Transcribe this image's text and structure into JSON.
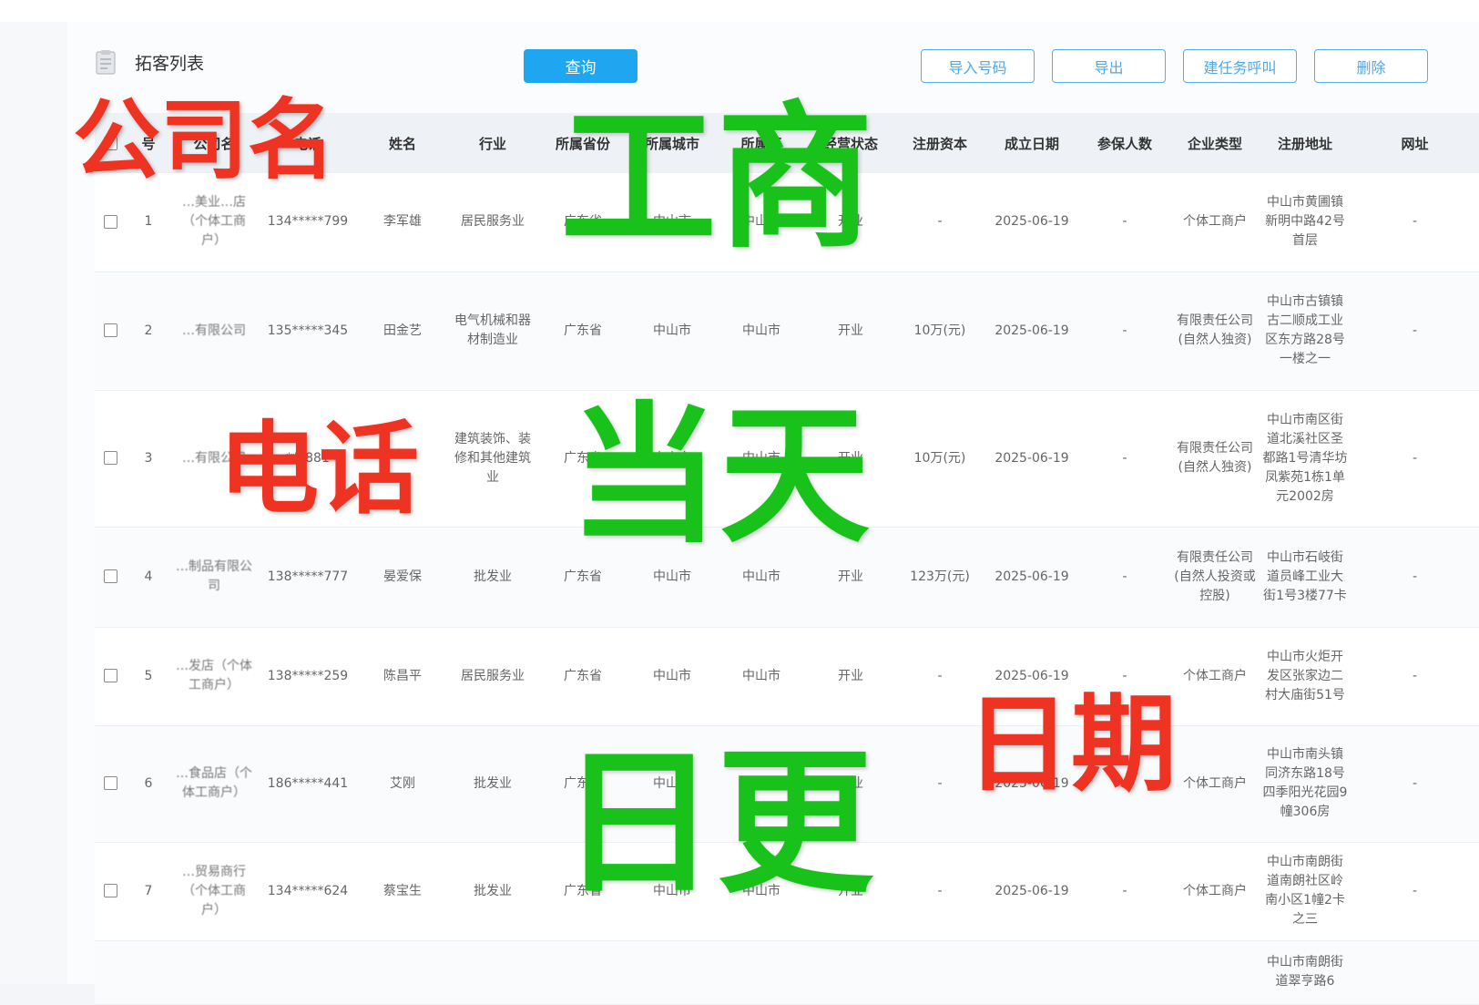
{
  "page": {
    "title": "拓客列表"
  },
  "toolbar": {
    "query": "查询",
    "import": "导入号码",
    "export": "导出",
    "create_task": "建任务呼叫",
    "delete": "删除"
  },
  "table": {
    "headers": [
      "号",
      "公司名",
      "电话",
      "姓名",
      "行业",
      "所属省份",
      "所属城市",
      "所属区",
      "经营状态",
      "注册资本",
      "成立日期",
      "参保人数",
      "企业类型",
      "注册地址",
      "网址"
    ],
    "rows": [
      {
        "no": "1",
        "company": "…美业…店（个体工商户）",
        "phone": "134*****799",
        "name": "李军雄",
        "industry": "居民服务业",
        "province": "广东省",
        "city": "中山市",
        "district": "中山市",
        "status": "开业",
        "capital": "-",
        "date": "2025-06-19",
        "insured": "-",
        "type": "个体工商户",
        "address": "中山市黄圃镇新明中路42号首层",
        "website": "-"
      },
      {
        "no": "2",
        "company": "…有限公司",
        "phone": "135*****345",
        "name": "田金艺",
        "industry": "电气机械和器材制造业",
        "province": "广东省",
        "city": "中山市",
        "district": "中山市",
        "status": "开业",
        "capital": "10万(元)",
        "date": "2025-06-19",
        "insured": "-",
        "type": "有限责任公司(自然人独资)",
        "address": "中山市古镇镇古二顺成工业区东方路28号一楼之一",
        "website": "-"
      },
      {
        "no": "3",
        "company": "…有限公司",
        "phone": "***881",
        "name": "-",
        "industry": "建筑装饰、装修和其他建筑业",
        "province": "广东省",
        "city": "中山市",
        "district": "中山市",
        "status": "开业",
        "capital": "10万(元)",
        "date": "2025-06-19",
        "insured": "-",
        "type": "有限责任公司(自然人独资)",
        "address": "中山市南区街道北溪社区圣都路1号清华坊凤紫苑1栋1单元2002房",
        "website": "-"
      },
      {
        "no": "4",
        "company": "…制品有限公司",
        "phone": "138*****777",
        "name": "晏爱保",
        "industry": "批发业",
        "province": "广东省",
        "city": "中山市",
        "district": "中山市",
        "status": "开业",
        "capital": "123万(元)",
        "date": "2025-06-19",
        "insured": "-",
        "type": "有限责任公司(自然人投资或控股)",
        "address": "中山市石岐街道员峰工业大街1号3楼77卡",
        "website": "-"
      },
      {
        "no": "5",
        "company": "…发店（个体工商户）",
        "phone": "138*****259",
        "name": "陈昌平",
        "industry": "居民服务业",
        "province": "广东省",
        "city": "中山市",
        "district": "中山市",
        "status": "开业",
        "capital": "-",
        "date": "2025-06-19",
        "insured": "-",
        "type": "个体工商户",
        "address": "中山市火炬开发区张家边二村大庙街51号",
        "website": "-"
      },
      {
        "no": "6",
        "company": "…食品店（个体工商户）",
        "phone": "186*****441",
        "name": "艾刚",
        "industry": "批发业",
        "province": "广东省",
        "city": "中山市",
        "district": "中山市",
        "status": "开业",
        "capital": "-",
        "date": "2025-06-19",
        "insured": "-",
        "type": "个体工商户",
        "address": "中山市南头镇同济东路18号四季阳光花园9幢306房",
        "website": "-"
      },
      {
        "no": "7",
        "company": "…贸易商行（个体工商户）",
        "phone": "134*****624",
        "name": "蔡宝生",
        "industry": "批发业",
        "province": "广东省",
        "city": "中山市",
        "district": "中山市",
        "status": "开业",
        "capital": "-",
        "date": "2025-06-19",
        "insured": "-",
        "type": "个体工商户",
        "address": "中山市南朗街道南朗社区岭南小区1幢2卡之三",
        "website": "-"
      },
      {
        "no": "",
        "company": "",
        "phone": "",
        "name": "",
        "industry": "",
        "province": "",
        "city": "",
        "district": "",
        "status": "",
        "capital": "",
        "date": "",
        "insured": "",
        "type": "",
        "address": "中山市南朗街道翠亨路6",
        "website": ""
      }
    ]
  },
  "overlay": {
    "company_name": "公司名",
    "phone": "电话",
    "date": "日期",
    "business": "工商",
    "same_day": "当天",
    "daily_update": "日更"
  },
  "colors": {
    "primary": "#1ea7f0",
    "overlay_red": "#ee3322",
    "overlay_green": "#19c21b"
  }
}
